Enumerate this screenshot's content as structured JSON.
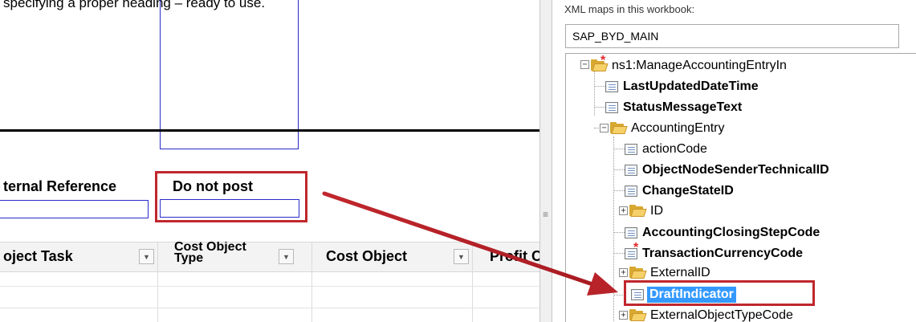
{
  "caption": "specifying a proper heading – ready to use.",
  "sheet": {
    "headers": {
      "external_reference": "ternal Reference",
      "do_not_post": "Do not post"
    },
    "grid_columns": [
      {
        "label": "oject Task"
      },
      {
        "label": "Cost Object Type"
      },
      {
        "label": "Cost Object"
      },
      {
        "label": "Profit C"
      }
    ]
  },
  "xml_pane": {
    "label": "XML maps in this workbook:",
    "selected_map": "SAP_BYD_MAIN",
    "tree": {
      "root": "ns1:ManageAccountingEntryIn",
      "last_updated": "LastUpdatedDateTime",
      "status_message": "StatusMessageText",
      "accounting_entry": "AccountingEntry",
      "action_code": "actionCode",
      "object_node": "ObjectNodeSenderTechnicalID",
      "change_state": "ChangeStateID",
      "id": "ID",
      "closing_step": "AccountingClosingStepCode",
      "currency": "TransactionCurrencyCode",
      "external_id": "ExternalID",
      "draft_indicator": "DraftIndicator",
      "external_object_type": "ExternalObjectTypeCode"
    }
  },
  "colors": {
    "highlight_red": "#c0272d",
    "selection_blue": "#3399ff",
    "cell_border_blue": "#2a2ac8",
    "folder": "#f6d068",
    "required_star": "#e3262a"
  }
}
